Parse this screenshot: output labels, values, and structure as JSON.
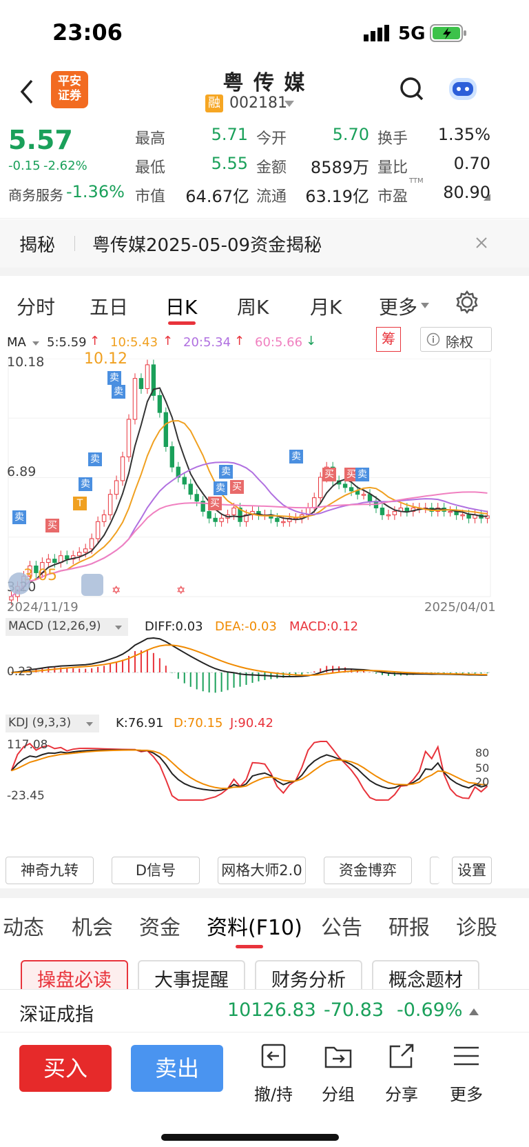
{
  "status": {
    "time": "23:06",
    "network": "5G"
  },
  "nav": {
    "broker_logo": "平安\n证券",
    "stock_name": "粤 传 媒",
    "margin_badge": "融",
    "stock_code": "002181"
  },
  "quote": {
    "price": "5.57",
    "change": "-0.15",
    "change_pct": "-2.62%",
    "sector": "商务服务",
    "sector_change": "-1.36%",
    "high_label": "最高",
    "high": "5.71",
    "low_label": "最低",
    "low": "5.55",
    "mcap_label": "市值",
    "mcap": "64.67亿",
    "open_label": "今开",
    "open": "5.70",
    "amount_label": "金额",
    "amount": "8589万",
    "float_label": "流通",
    "float": "63.19亿",
    "turnover_label": "换手",
    "turnover": "1.35%",
    "volratio_label": "量比",
    "volratio": "0.70",
    "pe_label": "市盈",
    "pe_sup": "TTM",
    "pe": "80.90"
  },
  "reveal": {
    "tag": "揭秘",
    "text": "粤传媒2025-05-09资金揭秘"
  },
  "period_tabs": [
    "分时",
    "五日",
    "日K",
    "周K",
    "月K",
    "更多"
  ],
  "ma_bar": {
    "label": "MA",
    "ma5": "5:5.59",
    "ma10": "10:5.43",
    "ma20": "20:5.34",
    "ma60": "60:5.66",
    "chips": "筹",
    "exright": "除权"
  },
  "chart_data": {
    "type": "candlestick",
    "title": "",
    "y_top_label": "10.18",
    "y_mid_label": "6.89",
    "y_bottom_label": "3.20",
    "high_mark": "10.12",
    "low_mark": "3.05",
    "x_start": "2024/11/19",
    "x_end": "2025/04/01",
    "ylim": [
      3.2,
      10.18
    ],
    "colors": {
      "up": "#e8333b",
      "down": "#1aa05a",
      "ma5": "#333333",
      "ma10": "#f0a020",
      "ma20": "#b070e0",
      "ma60": "#f080c0"
    },
    "close": [
      3.2,
      3.5,
      3.8,
      4.1,
      3.9,
      4.2,
      4.3,
      4.2,
      4.4,
      4.3,
      4.4,
      4.5,
      4.6,
      4.9,
      5.4,
      5.6,
      6.2,
      6.6,
      7.3,
      8.4,
      9.6,
      9.3,
      10.0,
      9.1,
      8.6,
      7.6,
      7.0,
      6.7,
      6.5,
      6.2,
      6.0,
      5.7,
      5.5,
      5.4,
      5.5,
      5.6,
      5.8,
      5.4,
      5.6,
      5.7,
      5.6,
      5.6,
      5.5,
      5.4,
      5.4,
      5.5,
      5.5,
      5.6,
      5.8,
      6.1,
      6.7,
      7.0,
      6.6,
      6.5,
      6.4,
      6.3,
      6.2,
      6.2,
      6.0,
      5.8,
      5.6,
      5.6,
      5.7,
      5.8,
      5.7,
      5.8,
      5.8,
      5.8,
      5.7,
      5.8,
      5.7,
      5.7,
      5.6,
      5.6,
      5.5,
      5.6,
      5.5,
      5.57
    ],
    "macd": {
      "label": "MACD (12,26,9)",
      "diff": "DIFF:0.03",
      "dea": "DEA:-0.03",
      "macd": "MACD:0.12",
      "zero_label": "0.23"
    },
    "kdj": {
      "label": "KDJ (9,3,3)",
      "k": "K:76.91",
      "d": "D:70.15",
      "j": "J:90.42",
      "top_label": "117.08",
      "bottom_label": "-23.45",
      "levels": [
        "80",
        "50",
        "20"
      ]
    }
  },
  "indicator_tools": [
    "神奇九转",
    "D信号",
    "网格大师2.0",
    "资金博弈",
    "设置"
  ],
  "section_tabs": [
    "动态",
    "机会",
    "资金",
    "资料(F10)",
    "公告",
    "研报",
    "诊股"
  ],
  "pills": [
    "操盘必读",
    "大事提醒",
    "财务分析",
    "概念题材"
  ],
  "index_bar": {
    "name": "深证成指",
    "value": "10126.83",
    "change": "-70.83",
    "pct": "-0.69%"
  },
  "bottom_bar": {
    "buy": "买入",
    "sell": "卖出",
    "items": [
      "撤/持",
      "分组",
      "分享",
      "更多"
    ]
  }
}
